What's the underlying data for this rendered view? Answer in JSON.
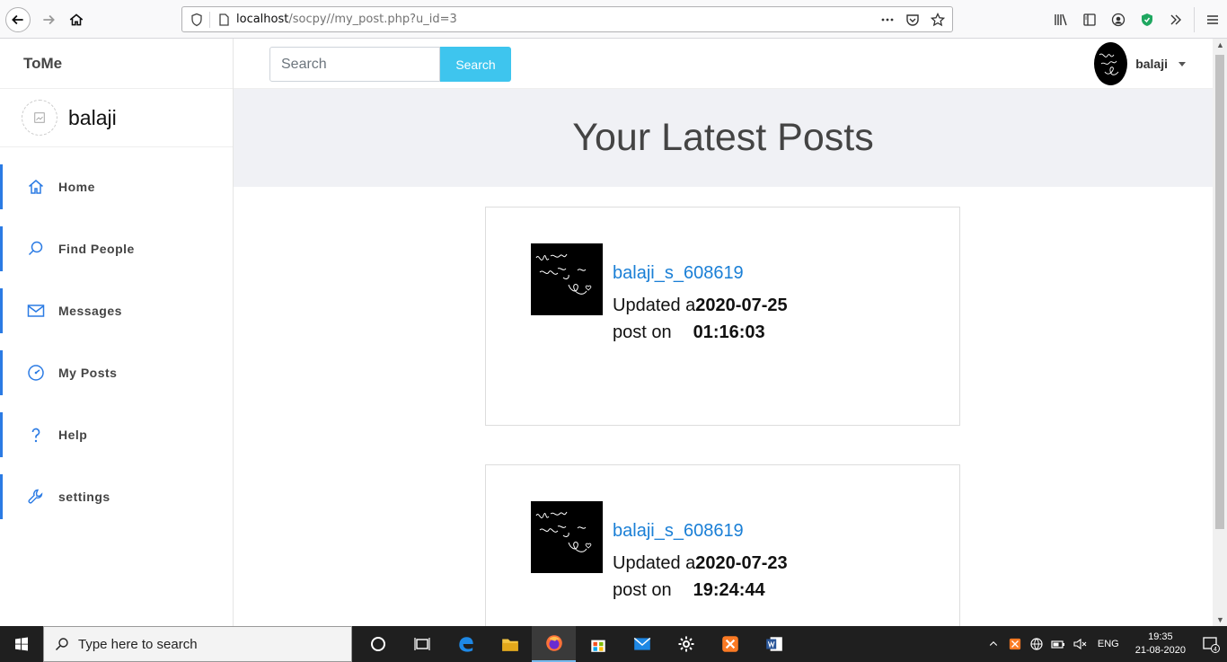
{
  "browser": {
    "url_host": "localhost",
    "url_path": "/socpy//my_post.php?u_id=3"
  },
  "app": {
    "brand": "ToMe",
    "profile_name": "balaji",
    "search_placeholder": "Search",
    "search_button": "Search",
    "user_name": "balaji"
  },
  "sidebar": {
    "items": [
      {
        "label": "Home",
        "icon": "home-icon"
      },
      {
        "label": "Find People",
        "icon": "search-icon"
      },
      {
        "label": "Messages",
        "icon": "mail-icon"
      },
      {
        "label": "My Posts",
        "icon": "dashboard-icon"
      },
      {
        "label": "Help",
        "icon": "question-icon"
      },
      {
        "label": "settings",
        "icon": "wrench-icon"
      }
    ]
  },
  "main": {
    "title": "Your Latest Posts",
    "posts": [
      {
        "user": "balaji_s_608619",
        "updated_label": "Updated a",
        "date": "2020-07-25",
        "post_label": "post on",
        "time": "01:16:03"
      },
      {
        "user": "balaji_s_608619",
        "updated_label": "Updated a",
        "date": "2020-07-23",
        "post_label": "post on",
        "time": "19:24:44"
      }
    ]
  },
  "taskbar": {
    "search_placeholder": "Type here to search",
    "lang": "ENG",
    "time": "19:35",
    "date": "21-08-2020",
    "notifications": "4"
  },
  "colors": {
    "accent": "#2b7be4",
    "search_button": "#3ec5ee",
    "link": "#1a7fd6",
    "hero_bg": "#f0f1f5"
  }
}
